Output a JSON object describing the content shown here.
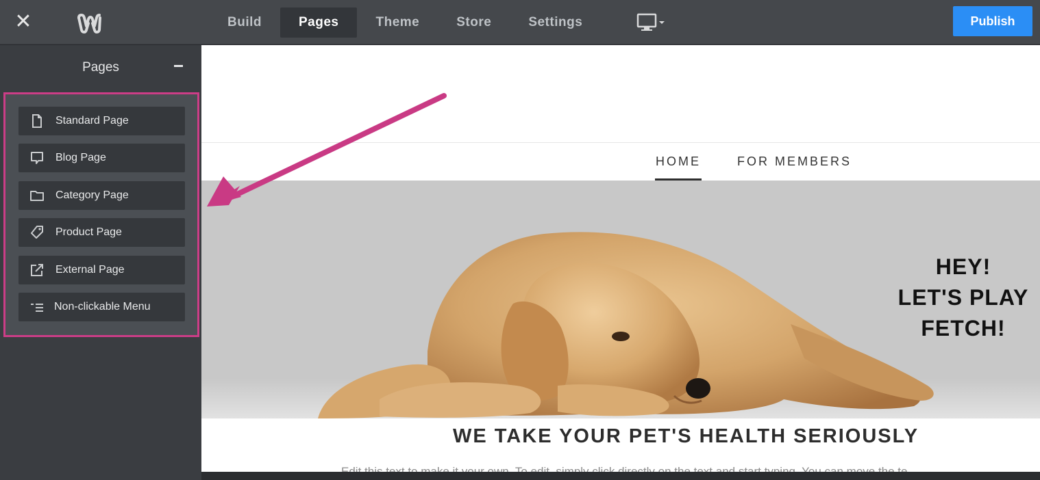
{
  "topbar": {
    "close_icon": "close-icon",
    "logo_icon": "weebly-logo-icon",
    "tabs": [
      {
        "label": "Build",
        "active": false
      },
      {
        "label": "Pages",
        "active": true
      },
      {
        "label": "Theme",
        "active": false
      },
      {
        "label": "Store",
        "active": false
      },
      {
        "label": "Settings",
        "active": false
      }
    ],
    "device_icon": "desktop-monitor-icon",
    "publish_label": "Publish"
  },
  "sidebar": {
    "title": "Pages",
    "collapse_icon": "minus-icon",
    "page_types": [
      {
        "label": "Standard Page",
        "icon": "document-icon"
      },
      {
        "label": "Blog Page",
        "icon": "speech-bubble-icon"
      },
      {
        "label": "Category Page",
        "icon": "folder-icon"
      },
      {
        "label": "Product Page",
        "icon": "tag-icon"
      },
      {
        "label": "External Page",
        "icon": "external-link-icon"
      },
      {
        "label": "Non-clickable Menu",
        "icon": "indented-list-icon"
      }
    ]
  },
  "preview": {
    "nav": [
      {
        "label": "HOME",
        "active": true
      },
      {
        "label": "FOR MEMBERS",
        "active": false
      }
    ],
    "hero": {
      "lines": [
        "HEY!",
        "LET'S PLAY",
        "FETCH!"
      ],
      "image": "golden-retriever-puppy"
    },
    "section_title": "WE TAKE YOUR PET'S HEALTH SERIOUSLY",
    "body_text": "Edit this text to make it your own. To edit, simply click directly on the text and start typing. You can move the te"
  },
  "colors": {
    "topbar": "#45484c",
    "sidebar": "#3a3d41",
    "publish": "#2b8ef5",
    "highlight": "#cc3d87",
    "hero_bg": "#c8c8c8"
  }
}
